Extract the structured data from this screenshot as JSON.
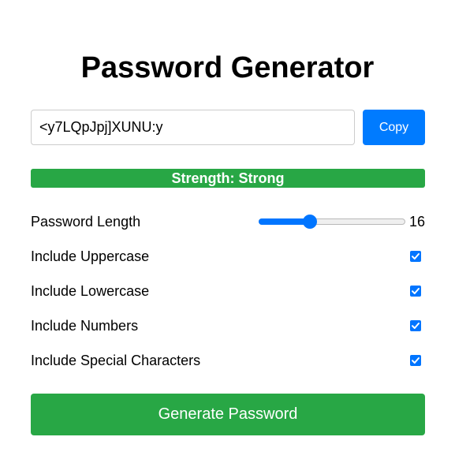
{
  "app": {
    "title": "Password Generator"
  },
  "password": {
    "value": "<y7LQpJpj]XUNU:y",
    "copy_label": "Copy"
  },
  "strength": {
    "label": "Strength: Strong",
    "color": "#28a745"
  },
  "options": {
    "length": {
      "label": "Password Length",
      "value": "16",
      "slider_fraction": 0.35
    },
    "uppercase": {
      "label": "Include Uppercase",
      "checked": true
    },
    "lowercase": {
      "label": "Include Lowercase",
      "checked": true
    },
    "numbers": {
      "label": "Include Numbers",
      "checked": true
    },
    "special": {
      "label": "Include Special Characters",
      "checked": true
    }
  },
  "generate": {
    "label": "Generate Password"
  },
  "colors": {
    "primary": "#007bff",
    "success": "#28a745",
    "control_accent": "#0075ff"
  },
  "icons": {
    "checkbox": "check-icon"
  }
}
